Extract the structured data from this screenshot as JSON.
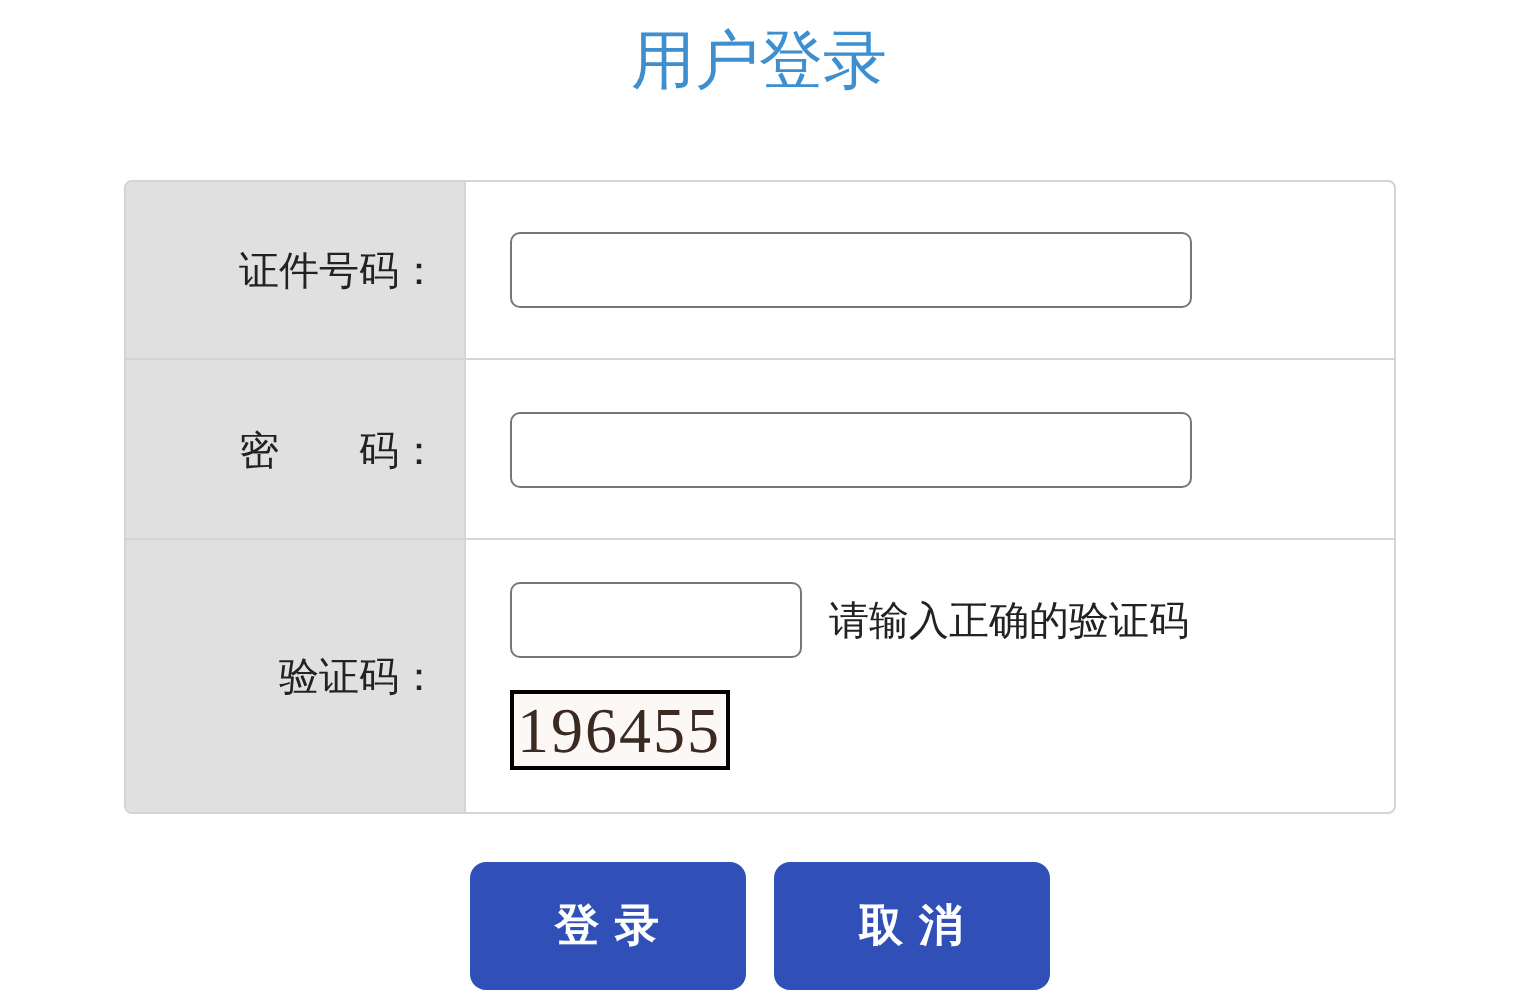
{
  "title": "用户登录",
  "form": {
    "rows": [
      {
        "kind": "text",
        "label": "证件号码："
      },
      {
        "kind": "password",
        "label": "密　　码："
      },
      {
        "kind": "captcha",
        "label": "验证码：",
        "hint": "请输入正确的验证码",
        "captcha": "196455"
      }
    ]
  },
  "buttons": [
    "登 录",
    "取 消"
  ]
}
